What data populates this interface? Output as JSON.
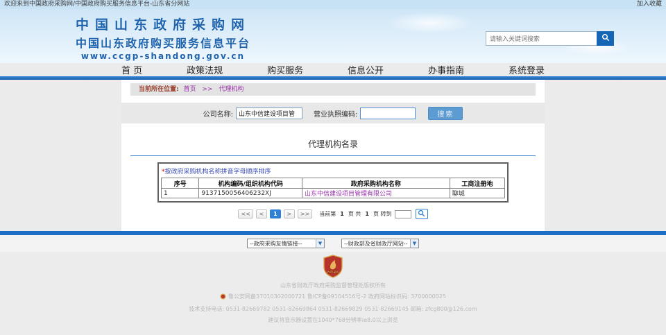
{
  "topbar": {
    "welcome": "欢迎来到中国政府采购网/中国政府购买服务信息平台-山东省分网站",
    "favorite": "加入收藏"
  },
  "header": {
    "logo_line1": "中国山东政府采购网",
    "logo_line2": "中国山东政府购买服务信息平台",
    "logo_url": "www.ccgp-shandong.gov.cn",
    "search_placeholder": "请输入关键词搜索",
    "search_icon": "magnifier"
  },
  "nav": {
    "items": [
      "首 页",
      "政策法规",
      "购买服务",
      "信息公开",
      "办事指南",
      "系统登录"
    ]
  },
  "breadcrumb": {
    "label": "当前所在位置:",
    "home": "首页",
    "separator": ">>",
    "current": "代理机构"
  },
  "search_form": {
    "company_label": "公司名称:",
    "company_value": "山东中信建设项目管",
    "license_label": "营业执照编码:",
    "license_value": "",
    "search_button": "搜索"
  },
  "directory": {
    "title": "代理机构名录",
    "note_star": "*",
    "note": "按政府采购机构名称拼音字母顺序排序",
    "table": {
      "headers": [
        "序号",
        "机构编码/组织机构代码",
        "政府采购机构名称",
        "工商注册地"
      ],
      "rows": [
        {
          "index": "1",
          "code": "9137150056406232XJ",
          "name": "山东中信建设项目管理有限公司",
          "location": "聊城"
        }
      ]
    },
    "pagination": {
      "first": "<<",
      "prev": "<",
      "page": "1",
      "next": ">",
      "last": ">>",
      "status_prefix": "当前第",
      "status_page": "1",
      "status_mid": "页 共",
      "status_total": "1",
      "status_suffix": "页 转到",
      "goto_icon": "magnifier"
    }
  },
  "footer": {
    "select_links": "--政府采购友情链接--",
    "select_gov": "--财政部及省财政厅网站--",
    "emblem_text": "政府采购",
    "copyright": "山东省财政厅政府采购监督管理处版权所有",
    "beian": "鲁公安网备37010302000721  鲁ICP备09104516号-2  政府网站标识码: 3700000025",
    "support": "技术支持电话: 0531-82669782 0531-82669864 0531-82669829 0531-82669145 邮箱: zfcg800@126.com",
    "resolution": "建议将显示器设置在1040*768分辨率ie8.0以上浏览"
  },
  "colors": {
    "brand_blue": "#1e63ad",
    "bar_blue": "#1e6fc3",
    "link_purple": "#9933aa",
    "note_blue": "#3b4db8",
    "active_page": "#2f80d5",
    "topbar_bg": "#c8e2f5",
    "emblem_red": "#b5332a",
    "emblem_gold": "#d9a652"
  }
}
